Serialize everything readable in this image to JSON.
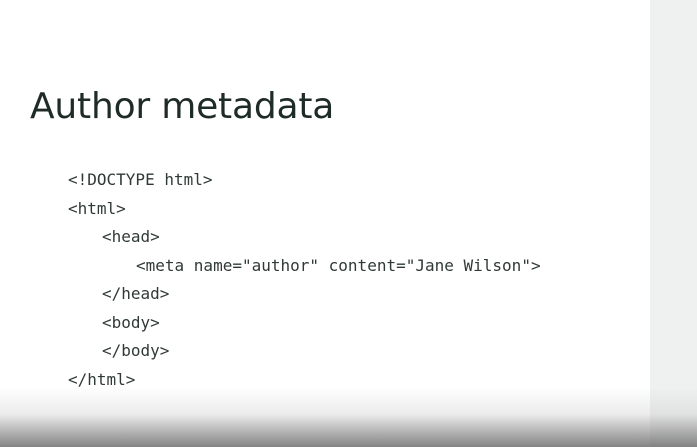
{
  "slide": {
    "title": "Author metadata",
    "code_lines": [
      "<!DOCTYPE html>",
      "<html>",
      "<head>",
      "<meta name=\"author\" content=\"Jane Wilson\">",
      "</head>",
      "<body>",
      "</body>",
      "</html>"
    ]
  }
}
